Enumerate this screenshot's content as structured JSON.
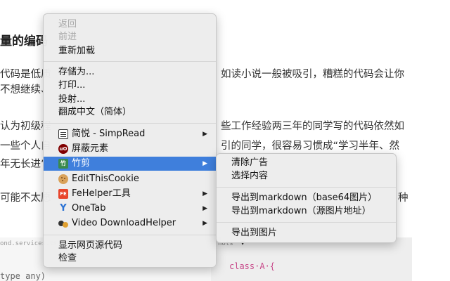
{
  "article": {
    "heading": "量的编码",
    "lines": [
      "代码是低质",
      "如读小说一般被吸引，糟糕的代码会让你",
      "不想继续、",
      "认为初级程",
      "些工作经验两三年的同学写的代码依然如",
      "一些个人自",
      "引的同学，很容易习惯成“学习半年、然",
      "年无长进”",
      "可能不太愿",
      "种"
    ],
    "code_tab": "ond.services.ts",
    "editor_tab": "nots",
    "code_right": "class·A·{",
    "code_left": "type any) "
  },
  "menu": {
    "items": [
      {
        "label": "返回",
        "disabled": true
      },
      {
        "label": "前进",
        "disabled": true
      },
      {
        "label": "重新加载"
      },
      {
        "label": "存储为..."
      },
      {
        "label": "打印..."
      },
      {
        "label": "投射..."
      },
      {
        "label": "翻成中文（简体）"
      },
      {
        "label": "简悦 - SimpRead",
        "icon": "simpread-icon",
        "submenu": true
      },
      {
        "label": "屏蔽元素",
        "icon": "ublock-icon"
      },
      {
        "label": "竹剪",
        "icon": "zhujian-icon",
        "submenu": true,
        "highlighted": true
      },
      {
        "label": "EditThisCookie",
        "icon": "cookie-icon"
      },
      {
        "label": "FeHelper工具",
        "icon": "fehelper-icon",
        "submenu": true
      },
      {
        "label": "OneTab",
        "icon": "onetab-icon",
        "submenu": true
      },
      {
        "label": "Video DownloadHelper",
        "icon": "video-downloadhelper-icon",
        "submenu": true
      },
      {
        "label": "显示网页源代码"
      },
      {
        "label": "检查"
      }
    ],
    "submenu_arrow": "▶",
    "icon_glyphs": {
      "ublock": "uO",
      "zhujian": "竹",
      "fehelper": "FE",
      "onetab": "Y"
    }
  },
  "submenu": {
    "items": [
      {
        "label": "清除广告"
      },
      {
        "label": "选择内容"
      },
      {
        "label": "导出到markdown（base64图片）"
      },
      {
        "label": "导出到markdown（源图片地址）"
      },
      {
        "label": "导出到图片"
      }
    ]
  },
  "colors": {
    "highlight": "#3f7fdc",
    "menu_bg": "#ececec",
    "disabled_text": "#a9a9a9"
  }
}
